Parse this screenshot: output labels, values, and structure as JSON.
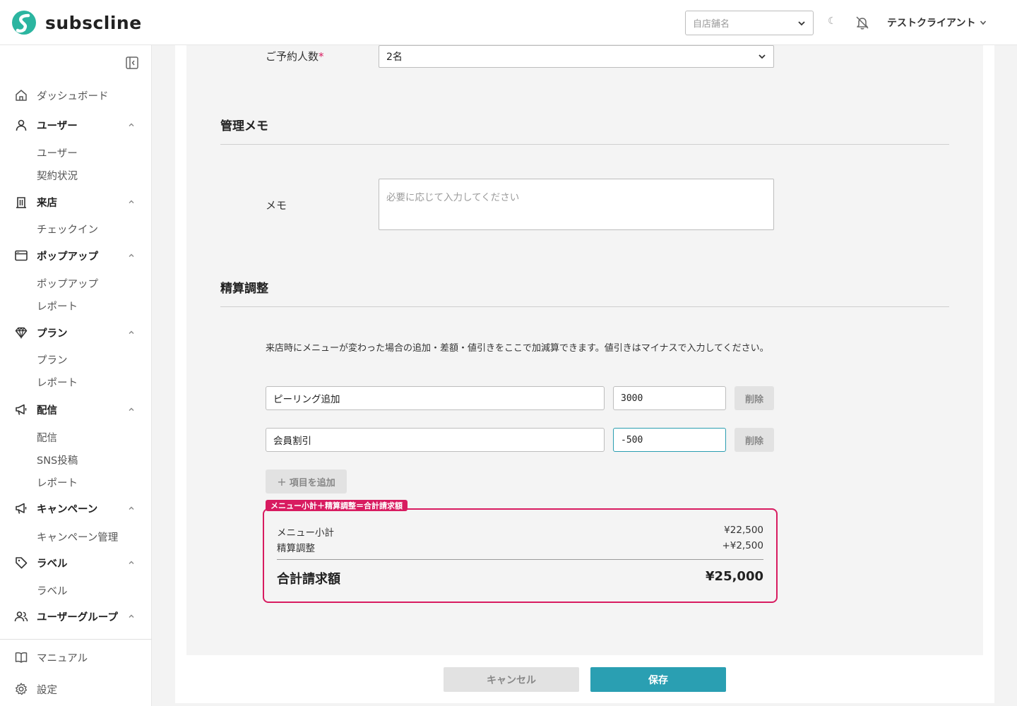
{
  "header": {
    "app_name": "subscline",
    "store_select_placeholder": "自店舗名",
    "moon_glyph": "☾",
    "client_name": "テストクライアント"
  },
  "sidebar": {
    "groups": [
      {
        "label": "ダッシュボード",
        "icon": "home-icon",
        "items": []
      },
      {
        "label": "ユーザー",
        "icon": "user-icon",
        "items": [
          "ユーザー",
          "契約状況"
        ]
      },
      {
        "label": "来店",
        "icon": "building-icon",
        "items": [
          "チェックイン"
        ]
      },
      {
        "label": "ポップアップ",
        "icon": "window-icon",
        "items": [
          "ポップアップ",
          "レポート"
        ]
      },
      {
        "label": "プラン",
        "icon": "diamond-icon",
        "items": [
          "プラン",
          "レポート"
        ]
      },
      {
        "label": "配信",
        "icon": "megaphone-icon",
        "items": [
          "配信",
          "SNS投稿",
          "レポート"
        ]
      },
      {
        "label": "キャンペーン",
        "icon": "megaphone-icon",
        "items": [
          "キャンペーン管理"
        ]
      },
      {
        "label": "ラベル",
        "icon": "tag-icon",
        "items": [
          "ラベル"
        ]
      },
      {
        "label": "ユーザーグループ",
        "icon": "users-icon",
        "items": []
      }
    ],
    "footer": [
      {
        "label": "マニュアル",
        "icon": "book-icon"
      },
      {
        "label": "設定",
        "icon": "gear-icon"
      }
    ]
  },
  "form": {
    "party_size": {
      "label": "ご予約人数",
      "required_mark": "*",
      "value": "2名"
    },
    "memo_section": {
      "title": "管理メモ",
      "memo_label": "メモ",
      "memo_placeholder": "必要に応じて入力してください"
    },
    "adjust_section": {
      "title": "精算調整",
      "help_text": "来店時にメニューが変わった場合の追加・差額・値引きをここで加減算できます。値引きはマイナスで入力してください。",
      "rows": [
        {
          "name": "ピーリング追加",
          "amount": "3000",
          "delete_label": "削除"
        },
        {
          "name": "会員割引",
          "amount": "-500",
          "delete_label": "削除"
        }
      ],
      "add_label": "項目を追加",
      "add_glyph": "+"
    },
    "summary": {
      "tag": "メニュー小計＋精算調整＝合計請求額",
      "subtotal_label": "メニュー小計",
      "subtotal_value": "¥22,500",
      "adjust_label": "精算調整",
      "adjust_value": "+¥2,500",
      "total_label": "合計請求額",
      "total_value": "¥25,000"
    }
  },
  "actions": {
    "cancel_label": "キャンセル",
    "save_label": "保存"
  },
  "colors": {
    "accent": "#2a9fb2",
    "highlight": "#d81b60"
  }
}
